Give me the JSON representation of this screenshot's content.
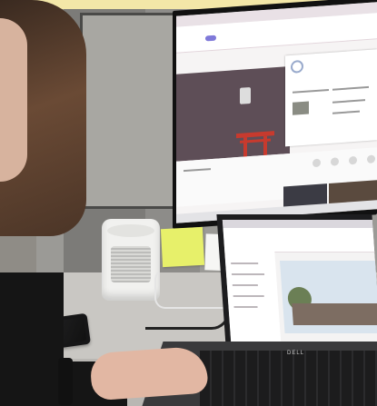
{
  "scene": {
    "laptop_brand": "DELL"
  },
  "colors": {
    "accent_purple": "#7f79d9",
    "torii_red": "#c73a2e",
    "sticky_yellow": "#e7f06a"
  }
}
